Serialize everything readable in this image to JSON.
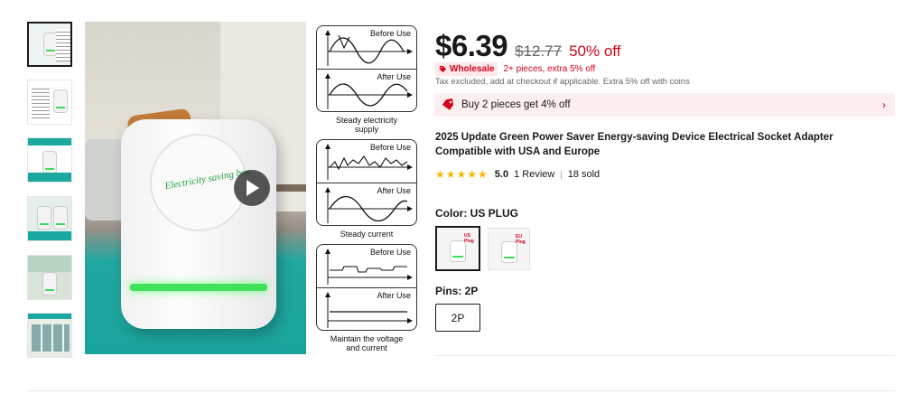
{
  "gallery": {
    "thumbnails": [
      {
        "name": "thumb-1",
        "selected": true
      },
      {
        "name": "thumb-2",
        "selected": false
      },
      {
        "name": "thumb-3",
        "selected": false
      },
      {
        "name": "thumb-4",
        "selected": false
      },
      {
        "name": "thumb-5",
        "selected": false
      },
      {
        "name": "thumb-6",
        "selected": false
      }
    ],
    "main_image": {
      "device_text": "Electricity saving box",
      "play_icon": "play-icon"
    },
    "diagram": {
      "panels": [
        {
          "top_label": "Before Use",
          "bottom_label": "After Use",
          "caption_line1": "Steady electricity",
          "caption_line2": "supply"
        },
        {
          "top_label": "Before Use",
          "bottom_label": "After Use",
          "caption_line1": "Steady current",
          "caption_line2": ""
        },
        {
          "top_label": "Before Use",
          "bottom_label": "After Use",
          "caption_line1": "Maintain the voltage",
          "caption_line2": "and current"
        }
      ]
    }
  },
  "product": {
    "price": "$6.39",
    "original_price": "$12.77",
    "discount": "50% off",
    "wholesale_badge": "Wholesale",
    "wholesale_text": "2+ pieces, extra 5% off",
    "tax_note": "Tax excluded, add at checkout if applicable. Extra 5% off with coins",
    "promo_text": "Buy 2 pieces get 4% off",
    "title": "2025 Update Green Power Saver Energy-saving Device Electrical Socket Adapter Compatible with USA and Europe",
    "stars": "★★★★★",
    "rating": "5.0",
    "reviews": "1 Review",
    "separator": "|",
    "sold": "18 sold",
    "color_label": "Color: US PLUG",
    "color_options": [
      {
        "label": "US Plug",
        "selected": true
      },
      {
        "label": "EU Plug",
        "selected": false
      }
    ],
    "pins_label": "Pins: 2P",
    "pin_option": "2P"
  },
  "colors": {
    "accent_red": "#d3031c",
    "star_gold": "#fdb600",
    "promo_bg": "#fdeef0"
  }
}
